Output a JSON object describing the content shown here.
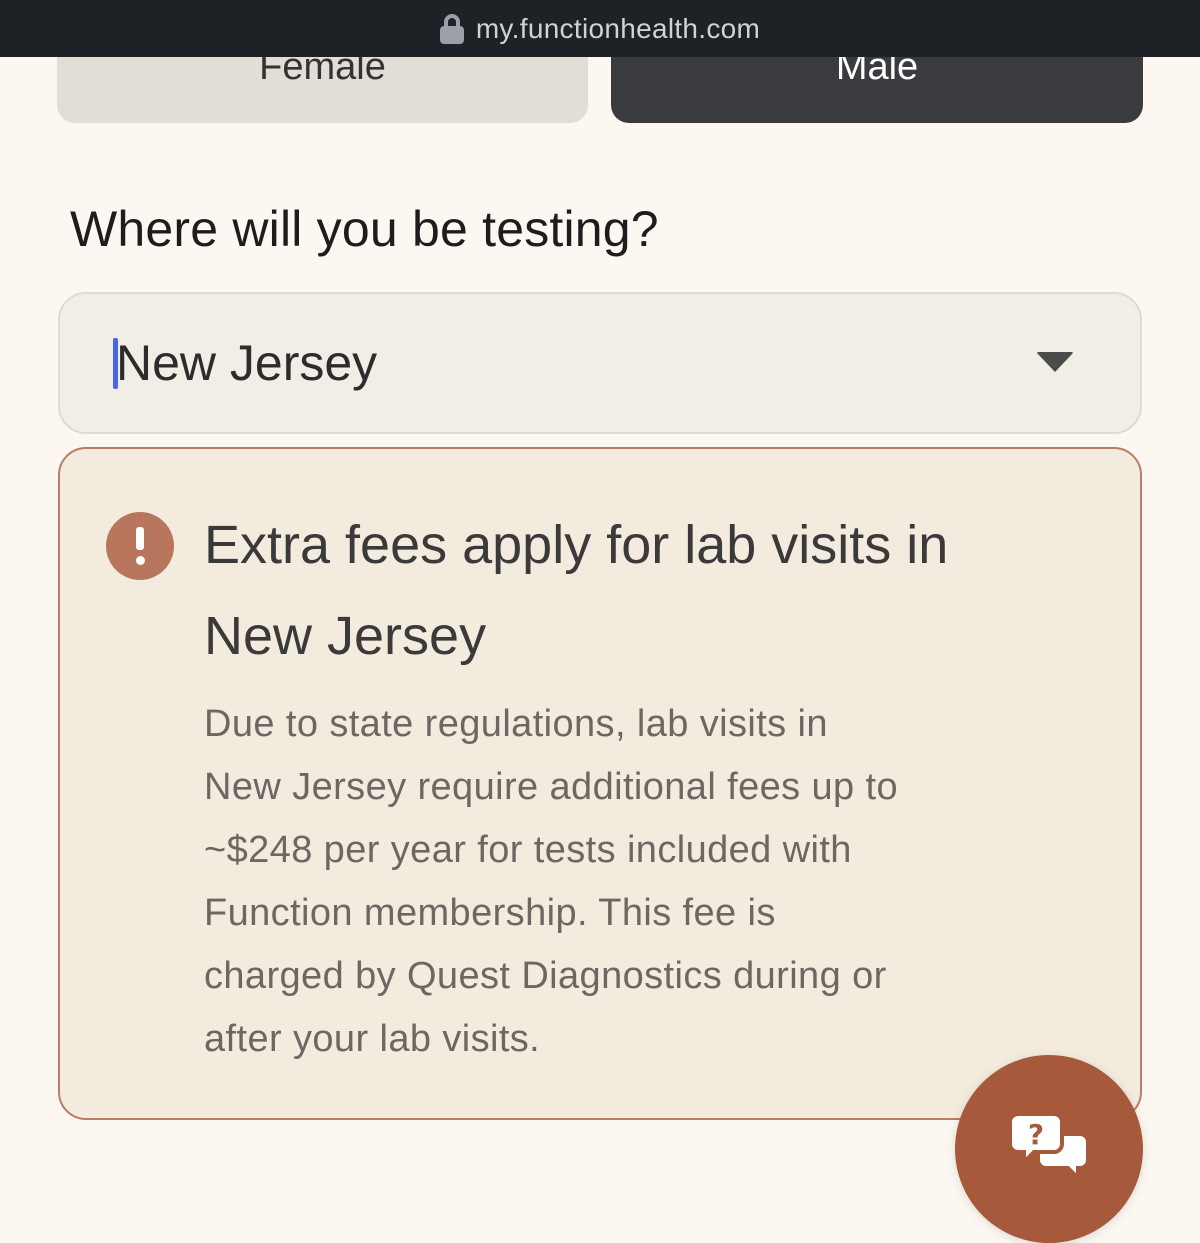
{
  "browser": {
    "url": "my.functionhealth.com",
    "lock_icon": "lock-icon"
  },
  "sex_toggle": {
    "options": [
      "Female",
      "Male"
    ],
    "selected": "Male"
  },
  "location": {
    "question": "Where will you be testing?",
    "selected_state": "New Jersey",
    "dropdown_icon": "chevron-down-icon"
  },
  "warning": {
    "icon": "alert-icon",
    "title_line1": "Extra fees apply for lab visits in",
    "title_line2": "New Jersey",
    "body_lines": [
      "Due to state regulations, lab visits in",
      "New Jersey require additional fees up to",
      "~$248 per year for tests included with",
      "Function membership. This fee is",
      "charged by Quest Diagnostics during or",
      "after your lab visits."
    ]
  },
  "help": {
    "icon": "help-chat-icon"
  },
  "colors": {
    "page_bg": "#fcf8f1",
    "urlbar_bg": "#1e2125",
    "selected_button": "#3a3b3f",
    "unselected_button": "#e1ded6",
    "warning_bg": "#f4ebdf",
    "warning_border": "#b87e64",
    "accent": "#a65a3b"
  }
}
